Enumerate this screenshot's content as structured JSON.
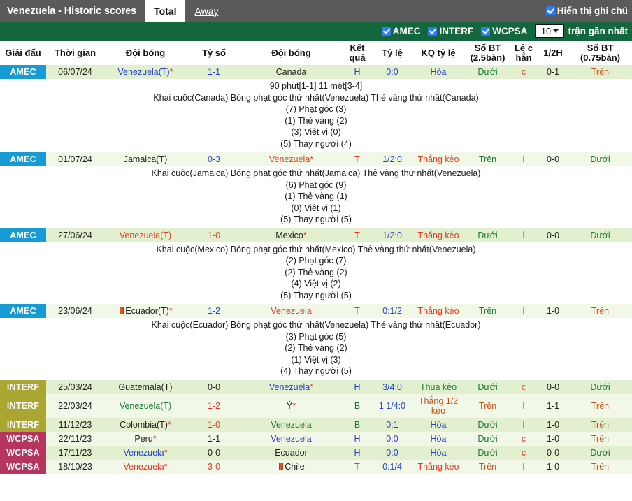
{
  "topbar": {
    "app_title": "Venezuela - Historic scores",
    "tabs": [
      {
        "label": "Total",
        "active": true
      },
      {
        "label": "Away",
        "active": false
      }
    ],
    "note_toggle_label": "Hiển thị ghi chú",
    "note_toggle_checked": true
  },
  "filterbar": {
    "filters": [
      {
        "label": "AMEC",
        "checked": true
      },
      {
        "label": "INTERF",
        "checked": true
      },
      {
        "label": "WCPSA",
        "checked": true
      }
    ],
    "match_count_value": "10",
    "count_suffix": "trận gần nhất"
  },
  "colors": {
    "topbar_bg": "#5a5a5a",
    "filterbar_bg": "#14663c",
    "checkbox_blue": "#2f7cf6",
    "league_amec": "#169bd5",
    "league_interf": "#a9a631",
    "league_wcpsa": "#b5355f",
    "row_even": "#e3f0cf",
    "row_odd": "#f2f8e8",
    "red": "#e03a22",
    "blue": "#2244cc",
    "green": "#1a7a34",
    "orange": "#c8531a"
  },
  "table": {
    "headers": [
      "Giải đấu",
      "Thời gian",
      "Đội bóng",
      "Tỷ số",
      "Đội bóng",
      "Kết quả",
      "Tỷ lệ",
      "KQ tỷ lệ",
      "Số BT (2.5bàn)",
      "Lẻ c hẳn",
      "1/2H",
      "Số BT (0.75bàn)"
    ],
    "rows": [
      {
        "league": "AMEC",
        "date": "06/07/24",
        "home": "Venezuela(T)",
        "home_color": "blue",
        "home_star": true,
        "home_card": false,
        "score": "1-1",
        "score_color": "blue",
        "away": "Canada",
        "away_color": "dark",
        "away_star": false,
        "away_card": false,
        "result": "H",
        "result_color": "blue",
        "odds": "0:0",
        "odds_color": "blue",
        "odds_result": "Hòa",
        "odds_result_color": "blue",
        "ou25": "Dưới",
        "ou25_color": "green",
        "oddeven": "c",
        "oddeven_color": "red",
        "half": "0-1",
        "half_color": "dark",
        "ou075": "Trên",
        "ou075_color": "orange",
        "detail": {
          "line1": "90 phút[1-1] 11 mét[3-4]",
          "line2": "Khai cuộc(Canada)  Bóng phạt góc thứ nhất(Venezuela)  Thẻ vàng thứ nhất(Canada)",
          "line3": "(7) Phạt góc (3)",
          "line4": "(1) Thẻ vàng (2)",
          "line5": "(3) Việt vị (0)",
          "line6": "(5) Thay người (4)"
        }
      },
      {
        "league": "AMEC",
        "date": "01/07/24",
        "home": "Jamaica(T)",
        "home_color": "dark",
        "home_star": false,
        "home_card": false,
        "score": "0-3",
        "score_color": "blue",
        "away": "Venezuela",
        "away_color": "red",
        "away_star": true,
        "away_card": false,
        "result": "T",
        "result_color": "red",
        "odds": "1/2:0",
        "odds_color": "blue",
        "odds_result": "Thắng kèo",
        "odds_result_color": "red",
        "ou25": "Trên",
        "ou25_color": "green",
        "oddeven": "l",
        "oddeven_color": "green",
        "half": "0-0",
        "half_color": "dark",
        "ou075": "Dưới",
        "ou075_color": "green",
        "detail": {
          "line1": "",
          "line2": "Khai cuộc(Jamaica)  Bóng phạt góc thứ nhất(Jamaica)  Thẻ vàng thứ nhất(Venezuela)",
          "line3": "(6) Phạt góc (9)",
          "line4": "(1) Thẻ vàng (1)",
          "line5": "(0) Việt vị (1)",
          "line6": "(5) Thay người (5)"
        }
      },
      {
        "league": "AMEC",
        "date": "27/06/24",
        "home": "Venezuela(T)",
        "home_color": "red",
        "home_star": false,
        "home_card": false,
        "score": "1-0",
        "score_color": "red",
        "away": "Mexico",
        "away_color": "dark",
        "away_star": true,
        "away_card": false,
        "result": "T",
        "result_color": "red",
        "odds": "1/2:0",
        "odds_color": "blue",
        "odds_result": "Thắng kèo",
        "odds_result_color": "red",
        "ou25": "Dưới",
        "ou25_color": "green",
        "oddeven": "l",
        "oddeven_color": "green",
        "half": "0-0",
        "half_color": "dark",
        "ou075": "Dưới",
        "ou075_color": "green",
        "detail": {
          "line1": "",
          "line2": "Khai cuộc(Mexico)  Bóng phạt góc thứ nhất(Mexico)  Thẻ vàng thứ nhất(Venezuela)",
          "line3": "(2) Phạt góc (7)",
          "line4": "(2) Thẻ vàng (2)",
          "line5": "(4) Việt vị (2)",
          "line6": "(5) Thay người (5)"
        }
      },
      {
        "league": "AMEC",
        "date": "23/06/24",
        "home": "Ecuador(T)",
        "home_color": "dark",
        "home_star": true,
        "home_card": true,
        "score": "1-2",
        "score_color": "blue",
        "away": "Venezuela",
        "away_color": "red",
        "away_star": false,
        "away_card": false,
        "result": "T",
        "result_color": "red",
        "odds": "0:1/2",
        "odds_color": "blue",
        "odds_result": "Thắng kèo",
        "odds_result_color": "red",
        "ou25": "Trên",
        "ou25_color": "green",
        "oddeven": "l",
        "oddeven_color": "green",
        "half": "1-0",
        "half_color": "dark",
        "ou075": "Trên",
        "ou075_color": "orange",
        "detail": {
          "line1": "",
          "line2": "Khai cuộc(Ecuador)  Bóng phạt góc thứ nhất(Venezuela)  Thẻ vàng thứ nhất(Ecuador)",
          "line3": "(3) Phạt góc (5)",
          "line4": "(2) Thẻ vàng (2)",
          "line5": "(1) Việt vị (3)",
          "line6": "(4) Thay người (5)"
        }
      },
      {
        "league": "INTERF",
        "date": "25/03/24",
        "home": "Guatemala(T)",
        "home_color": "dark",
        "home_star": false,
        "home_card": false,
        "score": "0-0",
        "score_color": "dark",
        "away": "Venezuela",
        "away_color": "blue",
        "away_star": true,
        "away_card": false,
        "result": "H",
        "result_color": "blue",
        "odds": "3/4:0",
        "odds_color": "blue",
        "odds_result": "Thua kèo",
        "odds_result_color": "green",
        "ou25": "Dưới",
        "ou25_color": "green",
        "oddeven": "c",
        "oddeven_color": "red",
        "half": "0-0",
        "half_color": "dark",
        "ou075": "Dưới",
        "ou075_color": "green",
        "detail": null
      },
      {
        "league": "INTERF",
        "date": "22/03/24",
        "home": "Venezuela(T)",
        "home_color": "green",
        "home_star": false,
        "home_card": false,
        "score": "1-2",
        "score_color": "red",
        "away": "Ý",
        "away_color": "dark",
        "away_star": true,
        "away_card": false,
        "result": "B",
        "result_color": "green",
        "odds": "1 1/4:0",
        "odds_color": "blue",
        "odds_result": "Thắng 1/2 kèo",
        "odds_result_color": "orange",
        "ou25": "Trên",
        "ou25_color": "orange",
        "oddeven": "l",
        "oddeven_color": "green",
        "half": "1-1",
        "half_color": "dark",
        "ou075": "Trên",
        "ou075_color": "orange",
        "detail": null
      },
      {
        "league": "INTERF",
        "date": "11/12/23",
        "home": "Colombia(T)",
        "home_color": "dark",
        "home_star": true,
        "home_card": false,
        "score": "1-0",
        "score_color": "red",
        "away": "Venezuela",
        "away_color": "green",
        "away_star": false,
        "away_card": false,
        "result": "B",
        "result_color": "green",
        "odds": "0:1",
        "odds_color": "blue",
        "odds_result": "Hòa",
        "odds_result_color": "blue",
        "ou25": "Dưới",
        "ou25_color": "green",
        "oddeven": "l",
        "oddeven_color": "green",
        "half": "1-0",
        "half_color": "dark",
        "ou075": "Trên",
        "ou075_color": "orange",
        "detail": null
      },
      {
        "league": "WCPSA",
        "date": "22/11/23",
        "home": "Peru",
        "home_color": "dark",
        "home_star": true,
        "home_card": false,
        "score": "1-1",
        "score_color": "dark",
        "away": "Venezuela",
        "away_color": "blue",
        "away_star": false,
        "away_card": false,
        "result": "H",
        "result_color": "blue",
        "odds": "0:0",
        "odds_color": "blue",
        "odds_result": "Hòa",
        "odds_result_color": "blue",
        "ou25": "Dưới",
        "ou25_color": "green",
        "oddeven": "c",
        "oddeven_color": "red",
        "half": "1-0",
        "half_color": "dark",
        "ou075": "Trên",
        "ou075_color": "orange",
        "detail": null
      },
      {
        "league": "WCPSA",
        "date": "17/11/23",
        "home": "Venezuela",
        "home_color": "blue",
        "home_star": true,
        "home_card": false,
        "score": "0-0",
        "score_color": "dark",
        "away": "Ecuador",
        "away_color": "dark",
        "away_star": false,
        "away_card": false,
        "result": "H",
        "result_color": "blue",
        "odds": "0:0",
        "odds_color": "blue",
        "odds_result": "Hòa",
        "odds_result_color": "blue",
        "ou25": "Dưới",
        "ou25_color": "green",
        "oddeven": "c",
        "oddeven_color": "red",
        "half": "0-0",
        "half_color": "dark",
        "ou075": "Dưới",
        "ou075_color": "green",
        "detail": null
      },
      {
        "league": "WCPSA",
        "date": "18/10/23",
        "home": "Venezuela",
        "home_color": "red",
        "home_star": true,
        "home_card": false,
        "score": "3-0",
        "score_color": "red",
        "away": "Chile",
        "away_color": "dark",
        "away_star": false,
        "away_card": true,
        "result": "T",
        "result_color": "red",
        "odds": "0:1/4",
        "odds_color": "blue",
        "odds_result": "Thắng kèo",
        "odds_result_color": "red",
        "ou25": "Trên",
        "ou25_color": "orange",
        "oddeven": "l",
        "oddeven_color": "green",
        "half": "1-0",
        "half_color": "dark",
        "ou075": "Trên",
        "ou075_color": "orange",
        "detail": null
      }
    ]
  }
}
